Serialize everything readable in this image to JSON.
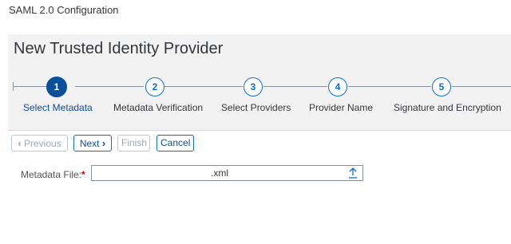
{
  "app": {
    "title": "SAML 2.0 Configuration"
  },
  "wizard": {
    "title": "New Trusted Identity Provider",
    "steps": [
      {
        "number": "1",
        "label": "Select Metadata",
        "active": true
      },
      {
        "number": "2",
        "label": "Metadata Verification",
        "active": false
      },
      {
        "number": "3",
        "label": "Select Providers",
        "active": false
      },
      {
        "number": "4",
        "label": "Provider Name",
        "active": false
      },
      {
        "number": "5",
        "label": "Signature and Encryption",
        "active": false
      }
    ]
  },
  "toolbar": {
    "previous_label": "Previous",
    "next_label": "Next",
    "finish_label": "Finish",
    "cancel_label": "Cancel"
  },
  "form": {
    "metadata_label": "Metadata File:",
    "required_marker": "*",
    "metadata_value": ".xml"
  },
  "colors": {
    "accent": "#0a6ed1",
    "active_step": "#0a4f99",
    "required": "#bb0000"
  },
  "icons": {
    "previous": "chevron-left-icon",
    "next": "chevron-right-icon",
    "upload": "upload-icon"
  }
}
